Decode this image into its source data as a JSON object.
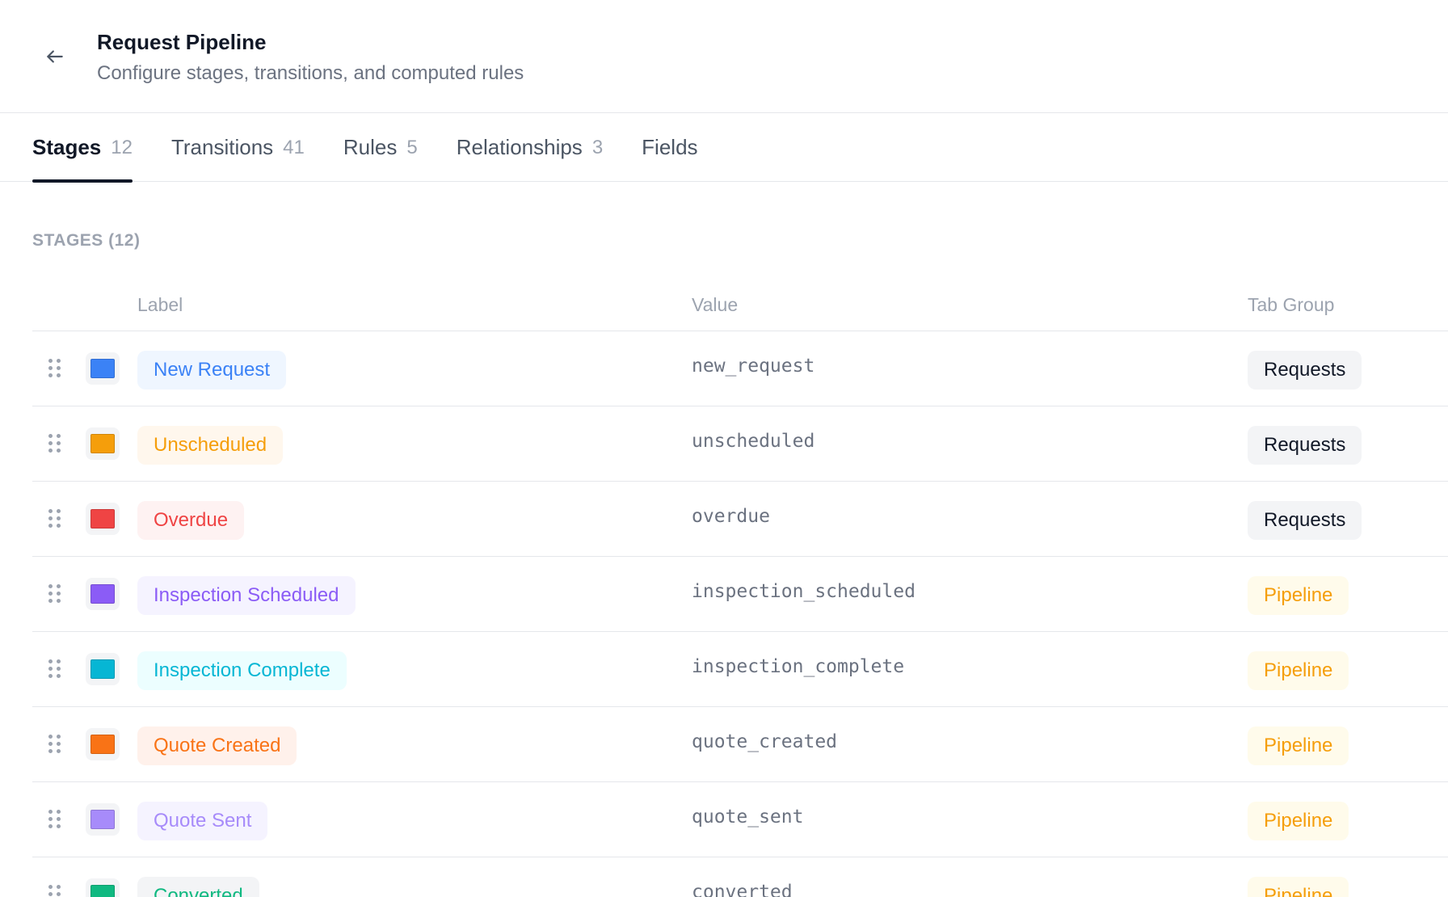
{
  "header": {
    "title": "Request Pipeline",
    "subtitle": "Configure stages, transitions, and computed rules"
  },
  "tabs": [
    {
      "label": "Stages",
      "count": "12"
    },
    {
      "label": "Transitions",
      "count": "41"
    },
    {
      "label": "Rules",
      "count": "5"
    },
    {
      "label": "Relationships",
      "count": "3"
    },
    {
      "label": "Fields",
      "count": ""
    }
  ],
  "section": {
    "title": "STAGES (12)"
  },
  "table": {
    "headers": {
      "label": "Label",
      "value": "Value",
      "group": "Tab Group"
    },
    "rows": [
      {
        "label": "New Request",
        "value": "new_request",
        "group": "Requests",
        "color": "#3b82f6",
        "pill_bg": "#eff6ff"
      },
      {
        "label": "Unscheduled",
        "value": "unscheduled",
        "group": "Requests",
        "color": "#f59e0b",
        "pill_bg": "#fff7ed"
      },
      {
        "label": "Overdue",
        "value": "overdue",
        "group": "Requests",
        "color": "#ef4444",
        "pill_bg": "#fef2f2"
      },
      {
        "label": "Inspection Scheduled",
        "value": "inspection_scheduled",
        "group": "Pipeline",
        "color": "#8b5cf6",
        "pill_bg": "#f5f3ff"
      },
      {
        "label": "Inspection Complete",
        "value": "inspection_complete",
        "group": "Pipeline",
        "color": "#06b6d4",
        "pill_bg": "#ecfeff"
      },
      {
        "label": "Quote Created",
        "value": "quote_created",
        "group": "Pipeline",
        "color": "#f97316",
        "pill_bg": "#fff1eb"
      },
      {
        "label": "Quote Sent",
        "value": "quote_sent",
        "group": "Pipeline",
        "color": "#a78bfa",
        "pill_bg": "#f5f3ff"
      },
      {
        "label": "Converted",
        "value": "converted",
        "group": "Pipeline",
        "color": "#10b981",
        "pill_bg": "#f3f4f6"
      }
    ]
  },
  "icons": {
    "back": "arrow-left-icon",
    "drag": "drag-handle-icon"
  }
}
